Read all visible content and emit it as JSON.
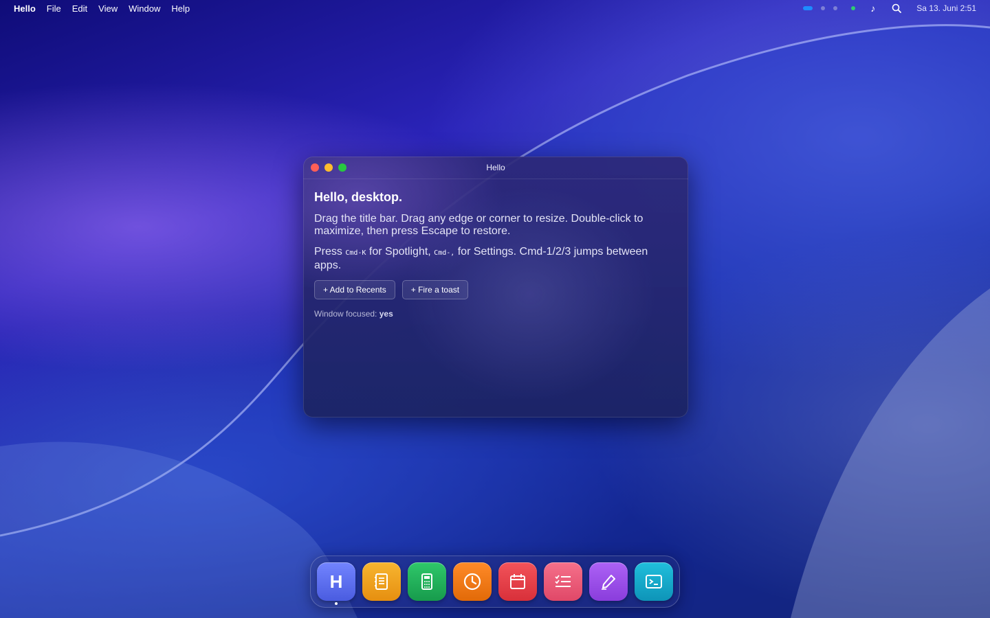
{
  "menubar": {
    "app_name": "Hello",
    "menus": [
      "File",
      "Edit",
      "View",
      "Window",
      "Help"
    ],
    "music_glyph": "♪",
    "datetime": "Sa 13. Juni 2:51"
  },
  "window": {
    "title": "Hello",
    "heading": "Hello, desktop.",
    "para1": "Drag the title bar. Drag any edge or corner to resize. Double-click to maximize, then press Escape to restore.",
    "para2": {
      "press": "Press ",
      "shortcut1": "Cmd-K",
      "for_spotlight": " for Spotlight, ",
      "shortcut2": "Cmd-,",
      "rest": " for Settings. Cmd-1/2/3 jumps between apps."
    },
    "buttons": {
      "add_recents": "+ Add to Recents",
      "fire_toast": "+ Fire a toast"
    },
    "focus_label": "Window focused:",
    "focus_value": "yes"
  },
  "dock": {
    "items": [
      {
        "name": "hello",
        "letter": "H",
        "color": "#5a6cf0"
      },
      {
        "name": "notes",
        "color": "#f0a020",
        "icon": "notebook-icon"
      },
      {
        "name": "calculator",
        "color": "#22b35c",
        "icon": "calculator-icon"
      },
      {
        "name": "clock",
        "color": "#f57a14",
        "icon": "clock-icon"
      },
      {
        "name": "calendar",
        "color": "#e84048",
        "icon": "calendar-icon"
      },
      {
        "name": "reminders",
        "color": "#ee5a78",
        "icon": "checklist-icon"
      },
      {
        "name": "draw",
        "color": "#9a4ee8",
        "icon": "pen-icon"
      },
      {
        "name": "terminal",
        "color": "#14a8c8",
        "icon": "terminal-icon"
      }
    ]
  }
}
